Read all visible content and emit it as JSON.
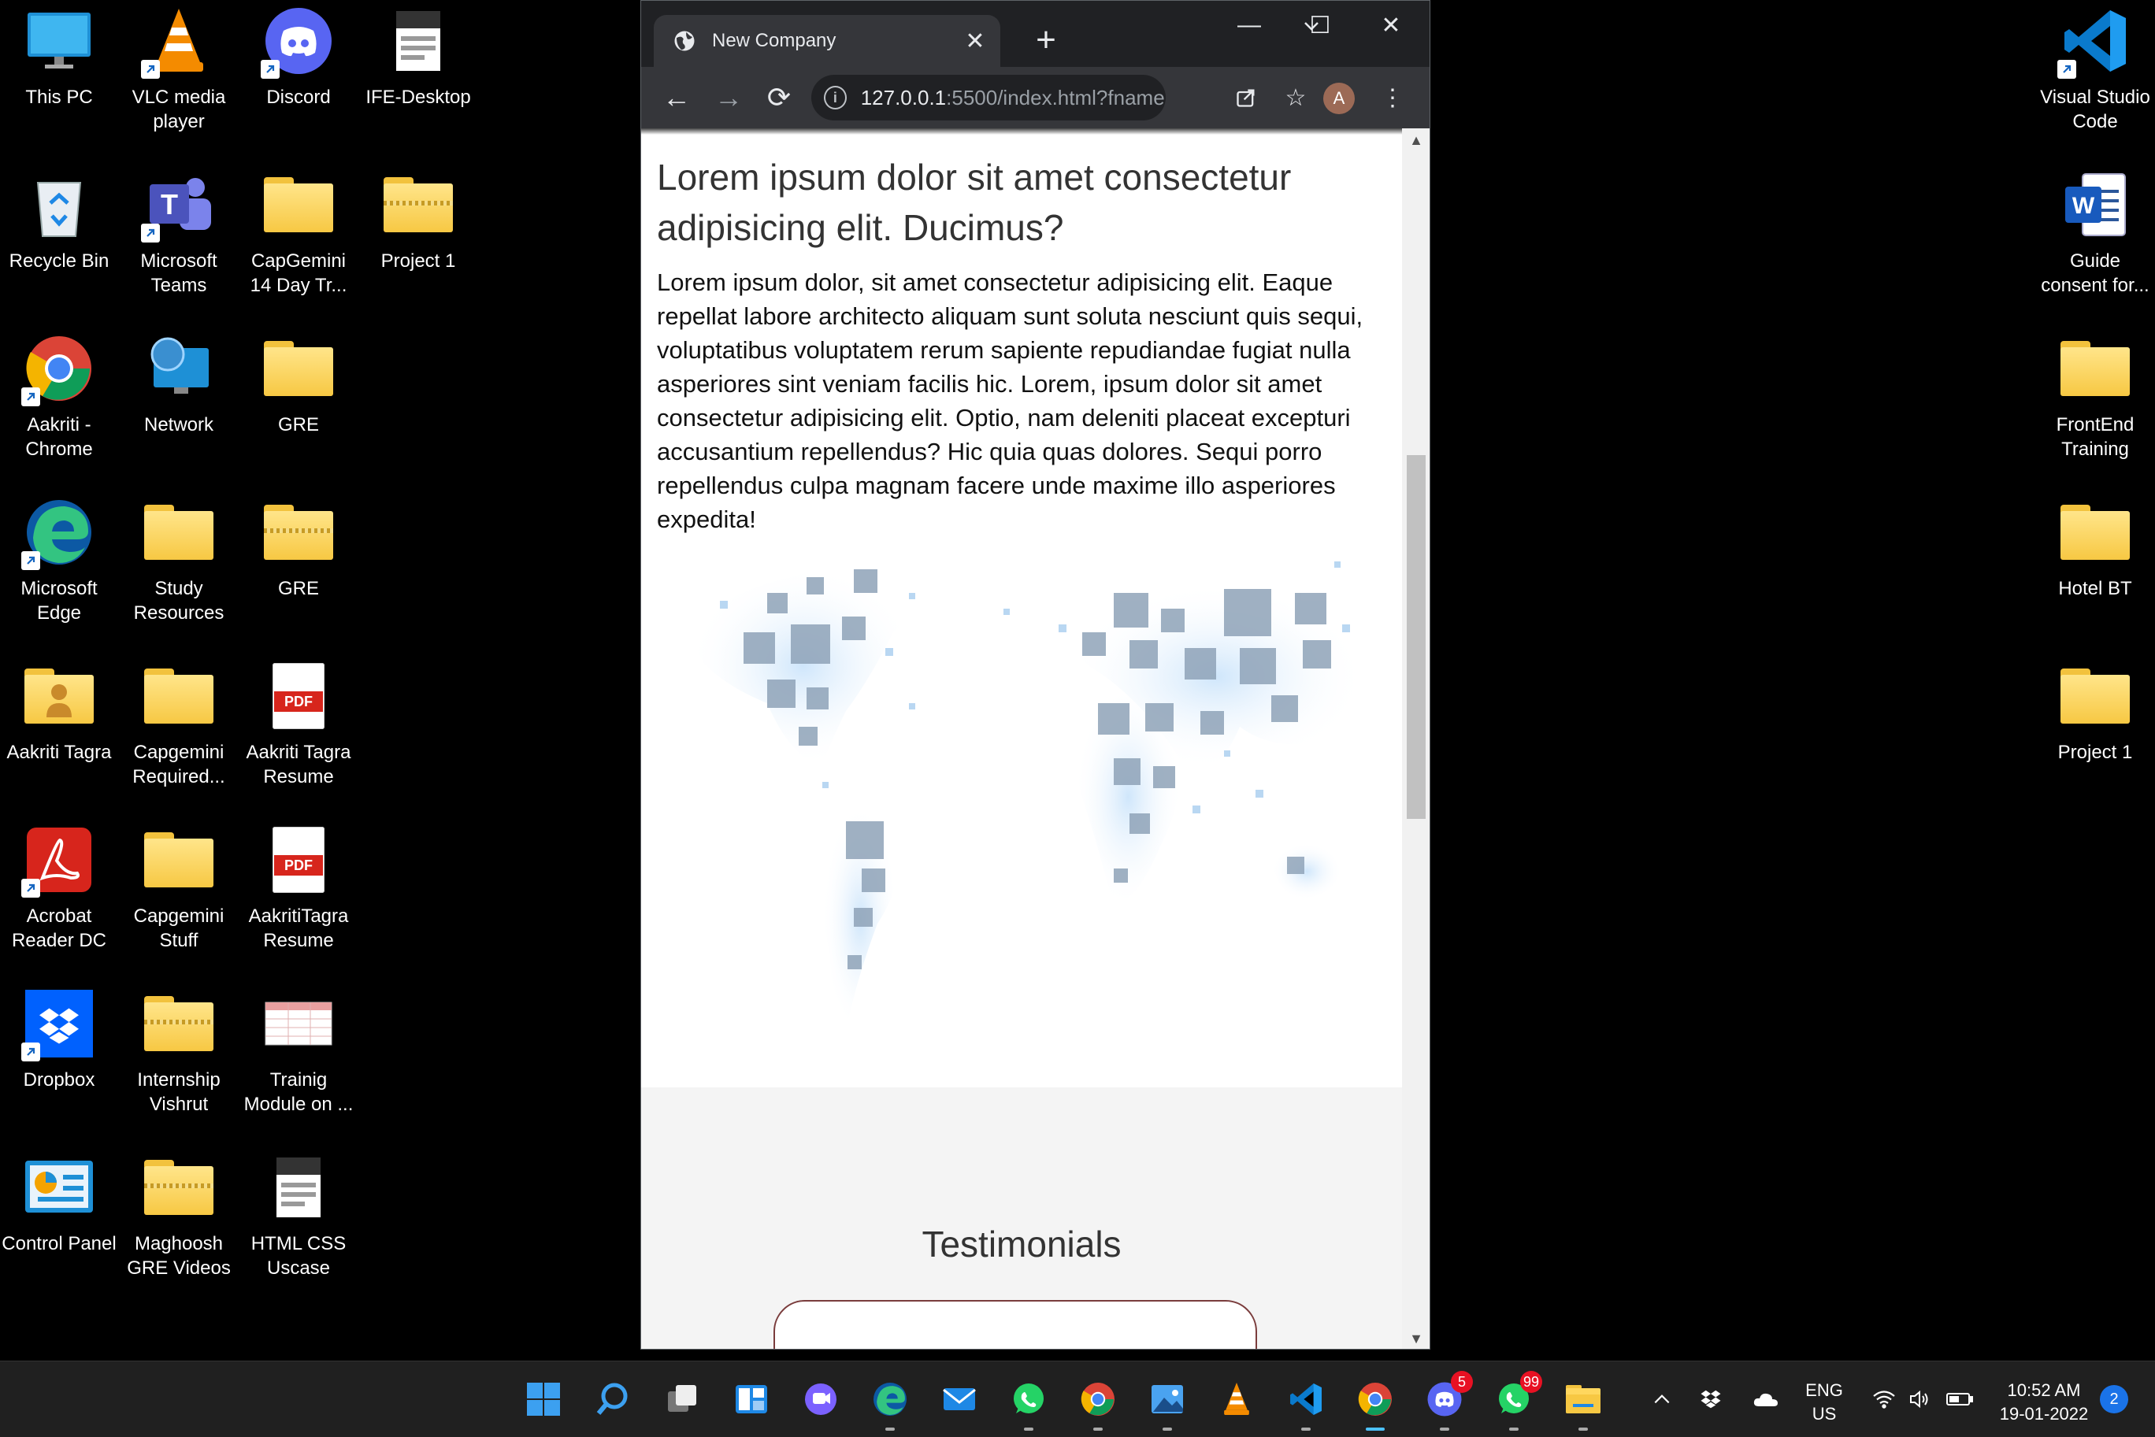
{
  "desktop": {
    "icons_left": [
      {
        "label": "This PC",
        "icon": "this-pc-icon"
      },
      {
        "label": "VLC media player",
        "icon": "vlc-icon"
      },
      {
        "label": "Discord",
        "icon": "discord-icon"
      },
      {
        "label": "IFE-Desktop",
        "icon": "file-icon"
      },
      {
        "label": "Recycle Bin",
        "icon": "recycle-bin-icon"
      },
      {
        "label": "Microsoft Teams",
        "icon": "teams-icon"
      },
      {
        "label": "CapGemini 14 Day Tr...",
        "icon": "folder-icon"
      },
      {
        "label": "Project 1",
        "icon": "zip-folder-icon"
      },
      {
        "label": "Aakriti - Chrome",
        "icon": "chrome-icon"
      },
      {
        "label": "Network",
        "icon": "network-icon"
      },
      {
        "label": "GRE",
        "icon": "folder-icon"
      },
      {
        "label": "Microsoft Edge",
        "icon": "edge-icon"
      },
      {
        "label": "Study Resources",
        "icon": "folder-icon"
      },
      {
        "label": "GRE",
        "icon": "zip-folder-icon"
      },
      {
        "label": "Aakriti Tagra",
        "icon": "user-folder-icon"
      },
      {
        "label": "Capgemini Required...",
        "icon": "folder-icon"
      },
      {
        "label": "Aakriti Tagra Resume",
        "icon": "pdf-icon"
      },
      {
        "label": "Acrobat Reader DC",
        "icon": "acrobat-icon"
      },
      {
        "label": "Capgemini Stuff",
        "icon": "folder-icon"
      },
      {
        "label": "AakritiTagra Resume",
        "icon": "pdf-icon"
      },
      {
        "label": "Dropbox",
        "icon": "dropbox-icon"
      },
      {
        "label": "Internship Vishrut",
        "icon": "zip-folder-icon"
      },
      {
        "label": "Trainig Module on ...",
        "icon": "spreadsheet-icon"
      },
      {
        "label": "Control Panel",
        "icon": "control-panel-icon"
      },
      {
        "label": "Maghoosh GRE Videos",
        "icon": "zip-folder-icon"
      },
      {
        "label": "HTML CSS Uscase",
        "icon": "file-icon"
      }
    ],
    "icons_right": [
      {
        "label": "Visual Studio Code",
        "icon": "vscode-icon"
      },
      {
        "label": "Guide consent for...",
        "icon": "word-icon"
      },
      {
        "label": "FrontEnd Training",
        "icon": "folder-icon"
      },
      {
        "label": "Hotel BT",
        "icon": "folder-icon"
      },
      {
        "label": "Project 1",
        "icon": "folder-icon"
      }
    ]
  },
  "browser": {
    "tab_title": "New Company",
    "url_host": "127.0.0.1",
    "url_rest": ":5500/index.html?fname...",
    "avatar_letter": "A",
    "window_controls": {
      "minimize": "—",
      "maximize": "☐",
      "close": "✕"
    }
  },
  "page": {
    "heading": "Lorem ipsum dolor sit amet consectetur adipisicing elit. Ducimus?",
    "paragraph": "Lorem ipsum dolor, sit amet consectetur adipisicing elit. Eaque repellat labore architecto aliquam sunt soluta nesciunt quis sequi, voluptatibus voluptatem rerum sapiente repudiandae fugiat nulla asperiores sint veniam facilis hic. Lorem, ipsum dolor sit amet consectetur adipisicing elit. Optio, nam deleniti placeat excepturi accusantium repellendus? Hic quia quas dolores. Sequi porro repellendus culpa magnam facere unde maxime illo asperiores expedita!",
    "testimonials_title": "Testimonials"
  },
  "taskbar": {
    "apps": [
      {
        "name": "start-button",
        "icon": "windows-icon"
      },
      {
        "name": "search-button",
        "icon": "search-icon"
      },
      {
        "name": "task-view-button",
        "icon": "task-view-icon"
      },
      {
        "name": "widgets-button",
        "icon": "widgets-icon"
      },
      {
        "name": "teams-chat-button",
        "icon": "chat-icon"
      },
      {
        "name": "edge-taskbar",
        "icon": "edge-icon"
      },
      {
        "name": "mail-taskbar",
        "icon": "mail-icon"
      },
      {
        "name": "whatsapp-taskbar",
        "icon": "whatsapp-icon"
      },
      {
        "name": "chrome-taskbar",
        "icon": "chrome-icon"
      },
      {
        "name": "photos-taskbar",
        "icon": "photos-icon"
      },
      {
        "name": "vlc-taskbar",
        "icon": "vlc-icon"
      },
      {
        "name": "vscode-taskbar",
        "icon": "vscode-icon"
      },
      {
        "name": "chrome-profile-taskbar",
        "icon": "chrome-icon"
      },
      {
        "name": "discord-taskbar",
        "icon": "discord-icon",
        "badge": "5"
      },
      {
        "name": "whatsapp-2-taskbar",
        "icon": "whatsapp-icon",
        "badge": "99"
      },
      {
        "name": "file-explorer-taskbar",
        "icon": "folder-icon"
      }
    ],
    "lang_line1": "ENG",
    "lang_line2": "US",
    "time": "10:52 AM",
    "date": "19-01-2022",
    "notifications": "2",
    "colors": {
      "taskbar_bg": "#202020",
      "accent": "#1a73e8"
    }
  }
}
